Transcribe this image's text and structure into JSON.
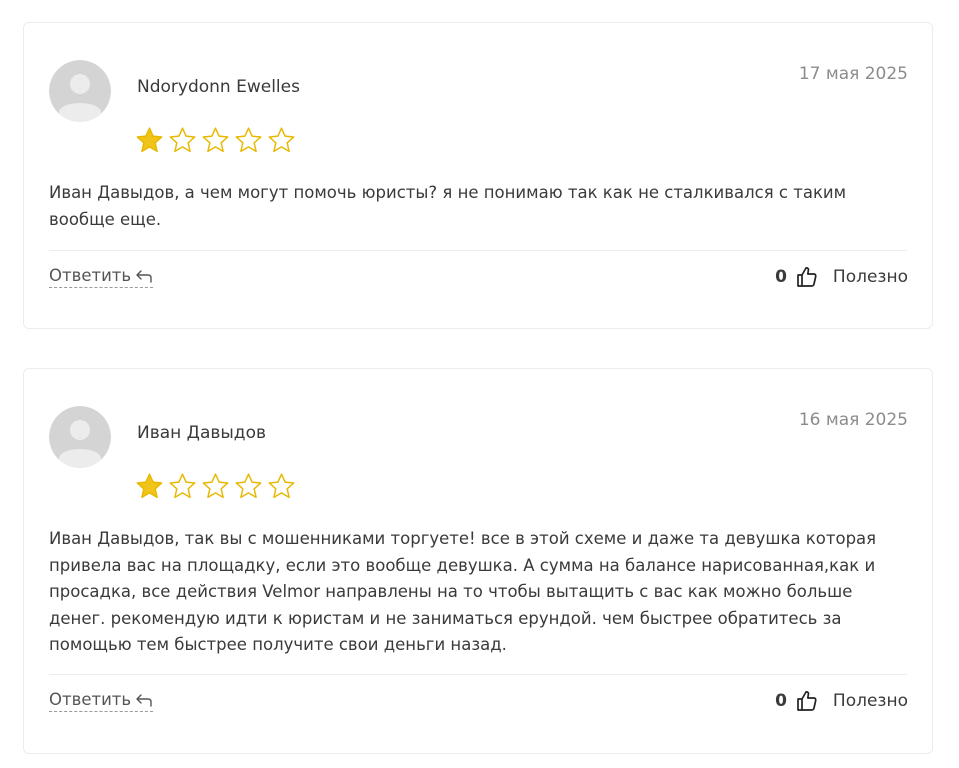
{
  "reviews": [
    {
      "author": "Ndorydonn Ewelles",
      "date": "17 мая 2025",
      "rating": 1,
      "max_rating": 5,
      "text": "Иван Давыдов, а чем могут помочь юристы? я не понимаю так как не сталкивался с таким вообще еще.",
      "reply_label": "Ответить",
      "useful_count": "0",
      "useful_label": "Полезно"
    },
    {
      "author": "Иван Давыдов",
      "date": "16 мая 2025",
      "rating": 1,
      "max_rating": 5,
      "text": "Иван Давыдов, так вы с мошенниками торгуете! все в этой схеме и даже та девушка которая привела вас на площадку, если это вообще девушка. А сумма на балансе нарисованная,как и просадка, все действия Velmor направлены на то чтобы вытащить с вас как можно больше денег. рекомендую идти к юристам и не заниматься ерундой. чем быстрее обратитесь за помощью тем быстрее получите свои деньги назад.",
      "reply_label": "Ответить",
      "useful_count": "0",
      "useful_label": "Полезно"
    }
  ],
  "colors": {
    "star": "#f0c419",
    "star_outline": "#e8b800"
  },
  "icons": {
    "avatar": "avatar-placeholder-icon",
    "star": "star-icon",
    "reply": "reply-arrow-icon",
    "like": "thumbs-up-icon"
  }
}
